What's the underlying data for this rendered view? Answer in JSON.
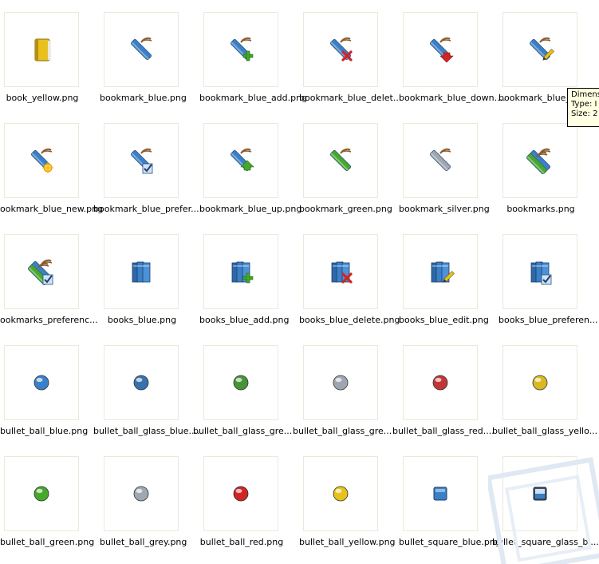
{
  "files": [
    {
      "name": "book_yellow.png",
      "icon": "book-yellow"
    },
    {
      "name": "bookmark_blue.png",
      "icon": "bookmark-blue"
    },
    {
      "name": "bookmark_blue_add.png",
      "icon": "bookmark-blue-add"
    },
    {
      "name": "bookmark_blue_delet...",
      "icon": "bookmark-blue-delete"
    },
    {
      "name": "bookmark_blue_down....",
      "icon": "bookmark-blue-down"
    },
    {
      "name": "bookmark_blue_edi",
      "icon": "bookmark-blue-edit"
    },
    {
      "name": "ookmark_blue_new.png",
      "icon": "bookmark-blue-new"
    },
    {
      "name": "bookmark_blue_prefer...",
      "icon": "bookmark-blue-preferences"
    },
    {
      "name": "bookmark_blue_up.png",
      "icon": "bookmark-blue-up"
    },
    {
      "name": "bookmark_green.png",
      "icon": "bookmark-green"
    },
    {
      "name": "bookmark_silver.png",
      "icon": "bookmark-silver"
    },
    {
      "name": "bookmarks.png",
      "icon": "bookmarks"
    },
    {
      "name": "ookmarks_preferenc...",
      "icon": "bookmarks-preferences"
    },
    {
      "name": "books_blue.png",
      "icon": "books-blue"
    },
    {
      "name": "books_blue_add.png",
      "icon": "books-blue-add"
    },
    {
      "name": "books_blue_delete.png",
      "icon": "books-blue-delete"
    },
    {
      "name": "books_blue_edit.png",
      "icon": "books-blue-edit"
    },
    {
      "name": "books_blue_preferen...",
      "icon": "books-blue-preferences"
    },
    {
      "name": "bullet_ball_blue.png",
      "icon": "bullet-ball-blue"
    },
    {
      "name": "bullet_ball_glass_blue....",
      "icon": "bullet-ball-glass-blue"
    },
    {
      "name": "bullet_ball_glass_gre...",
      "icon": "bullet-ball-glass-green"
    },
    {
      "name": "bullet_ball_glass_gre...",
      "icon": "bullet-ball-glass-grey"
    },
    {
      "name": "bullet_ball_glass_red....",
      "icon": "bullet-ball-glass-red"
    },
    {
      "name": "bullet_ball_glass_yello...",
      "icon": "bullet-ball-glass-yellow"
    },
    {
      "name": "bullet_ball_green.png",
      "icon": "bullet-ball-green"
    },
    {
      "name": "bullet_ball_grey.png",
      "icon": "bullet-ball-grey"
    },
    {
      "name": "bullet_ball_red.png",
      "icon": "bullet-ball-red"
    },
    {
      "name": "bullet_ball_yellow.png",
      "icon": "bullet-ball-yellow"
    },
    {
      "name": "bullet_square_blue.png",
      "icon": "bullet-square-blue"
    },
    {
      "name": "bullet_square_glass_bl...",
      "icon": "bullet-square-glass-blue"
    }
  ],
  "tooltip": {
    "line1": "Dimens",
    "line2": "Type: I",
    "line3": "Size: 2"
  },
  "colors": {
    "thumb_border": "#ece9d8",
    "tooltip_bg": "#ffffe1",
    "blue": "#3a7fc8",
    "green": "#46a82a",
    "red": "#d22424",
    "yellow": "#e8c21a",
    "grey": "#a0a7b0",
    "strap": "#8b5a2b"
  }
}
